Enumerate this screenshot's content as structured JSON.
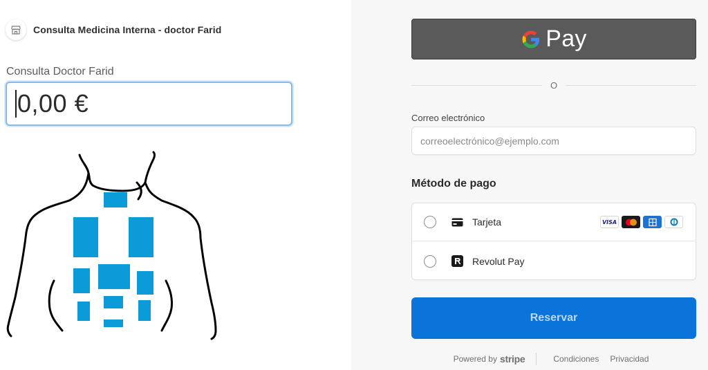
{
  "merchant": {
    "name": "Consulta Medicina Interna - doctor Farid",
    "icon": "store-icon"
  },
  "product": {
    "label": "Consulta Doctor Farid",
    "amount": "0,00 €"
  },
  "payment": {
    "gpay": {
      "brand_letter": "G",
      "word": "Pay"
    },
    "divider_text": "O",
    "email": {
      "label": "Correo electrónico",
      "placeholder": "correoelectrónico@ejemplo.com",
      "value": ""
    },
    "method_title": "Método de pago",
    "methods": [
      {
        "label": "Tarjeta",
        "icon": "card-icon",
        "brands": [
          "VISA",
          "mastercard",
          "AMEX",
          "diners"
        ]
      },
      {
        "label": "Revolut Pay",
        "icon": "revolut-icon"
      }
    ],
    "submit_label": "Reservar"
  },
  "footer": {
    "powered_by": "Powered by",
    "stripe": "stripe",
    "links": [
      "Condiciones",
      "Privacidad"
    ]
  },
  "colors": {
    "accent": "#0a74da",
    "gpay_bg": "#5a5a5a",
    "marker": "#0a9bd8"
  }
}
